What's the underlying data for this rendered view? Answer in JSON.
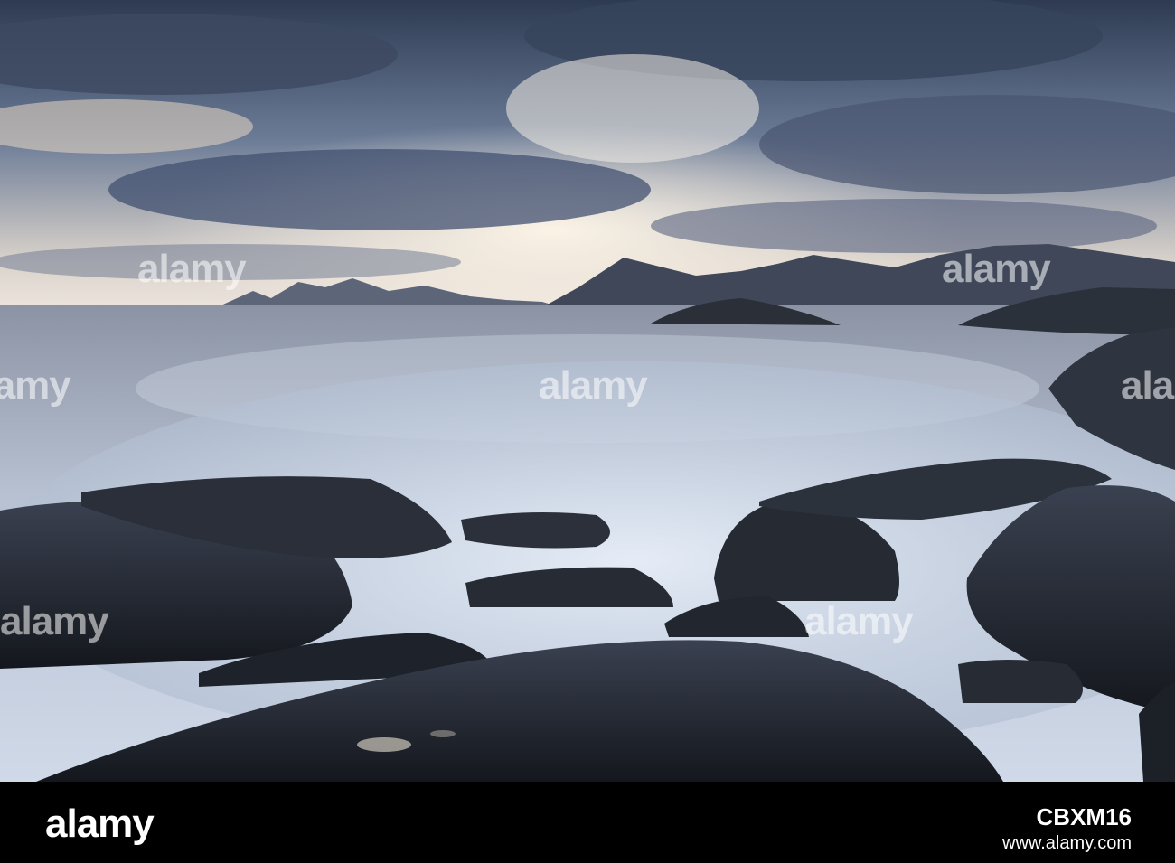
{
  "watermark": {
    "text": "alamy"
  },
  "footer": {
    "logo_text": "alamy",
    "image_id": "CBXM16",
    "site": "www.alamy.com"
  },
  "colors": {
    "sky_dark": "#2d3a52",
    "sky_light": "#f3e7d6",
    "sea": "#b7c1d3",
    "mist": "#d6e0ee",
    "rock": "#1f242d",
    "footer_bg": "#000000"
  }
}
